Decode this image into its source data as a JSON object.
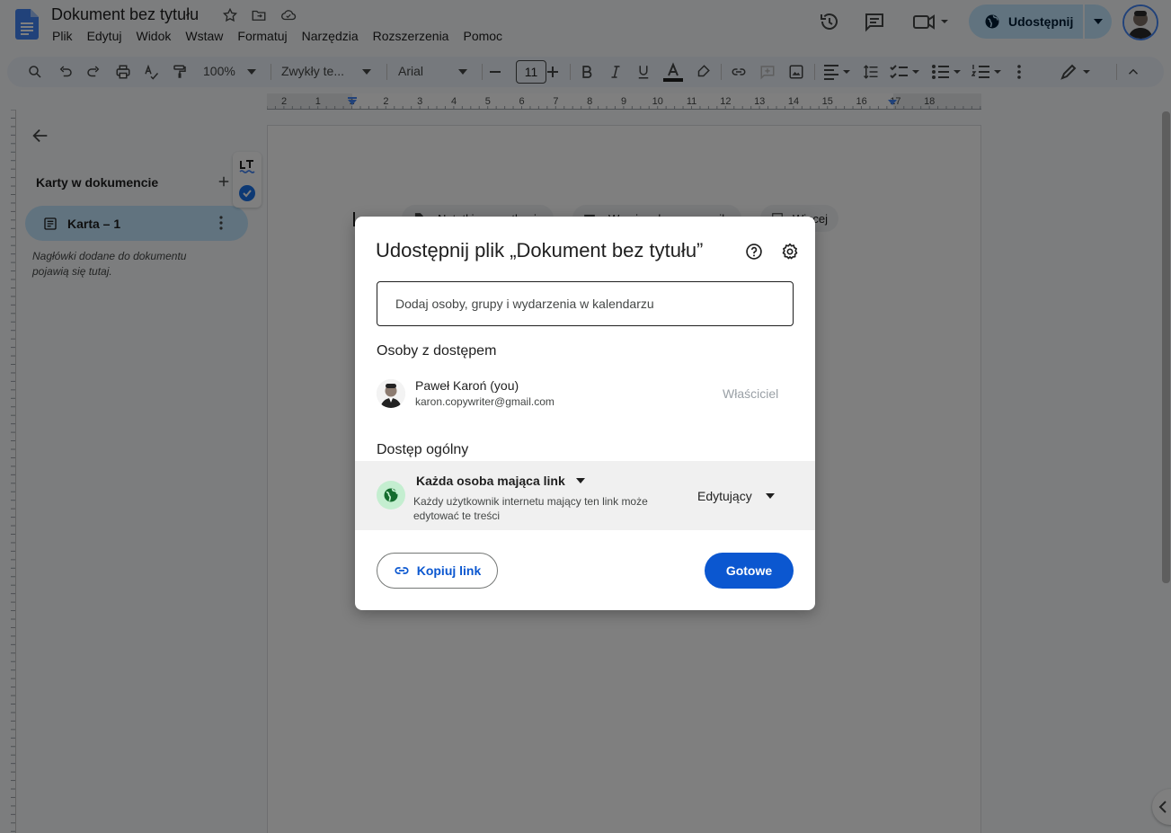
{
  "header": {
    "doc_title": "Dokument bez tytułu",
    "menu": [
      "Plik",
      "Edytuj",
      "Widok",
      "Wstaw",
      "Formatuj",
      "Narzędzia",
      "Rozszerzenia",
      "Pomoc"
    ],
    "share_label": "Udostępnij"
  },
  "toolbar": {
    "zoom": "100%",
    "style": "Zwykły te...",
    "font": "Arial",
    "font_size": "11"
  },
  "ruler": {
    "numbers": [
      "2",
      "1",
      "1",
      "2",
      "3",
      "4",
      "5",
      "6",
      "7",
      "8",
      "9",
      "10",
      "11",
      "12",
      "13",
      "14",
      "15",
      "16",
      "17",
      "18"
    ]
  },
  "sidebar": {
    "tabs_title": "Karty w dokumencie",
    "tab_label": "Karta – 1",
    "hint": "Nagłówki dodane do dokumentu pojawią się tutaj."
  },
  "page": {
    "chips": [
      "Notatki ze spotkania",
      "Wersja robocza e-maila",
      "Więcej"
    ]
  },
  "dialog": {
    "title": "Udostępnij plik „Dokument bez tytułu”",
    "add_people_placeholder": "Dodaj osoby, grupy i wydarzenia w kalendarzu",
    "access_heading": "Osoby z dostępem",
    "person": {
      "name": "Paweł Karoń (you)",
      "email": "karon.copywriter@gmail.com",
      "role": "Właściciel"
    },
    "general_heading": "Dostęp ogólny",
    "link_scope": "Każda osoba mająca link",
    "link_description": "Każdy użytkownik internetu mający ten link może edytować te treści",
    "role": "Edytujący",
    "copy_link": "Kopiuj link",
    "done": "Gotowe"
  },
  "colors": {
    "primary": "#0b57d0",
    "share_bg": "#c2e7ff",
    "globe_bg": "#c4eed0"
  }
}
